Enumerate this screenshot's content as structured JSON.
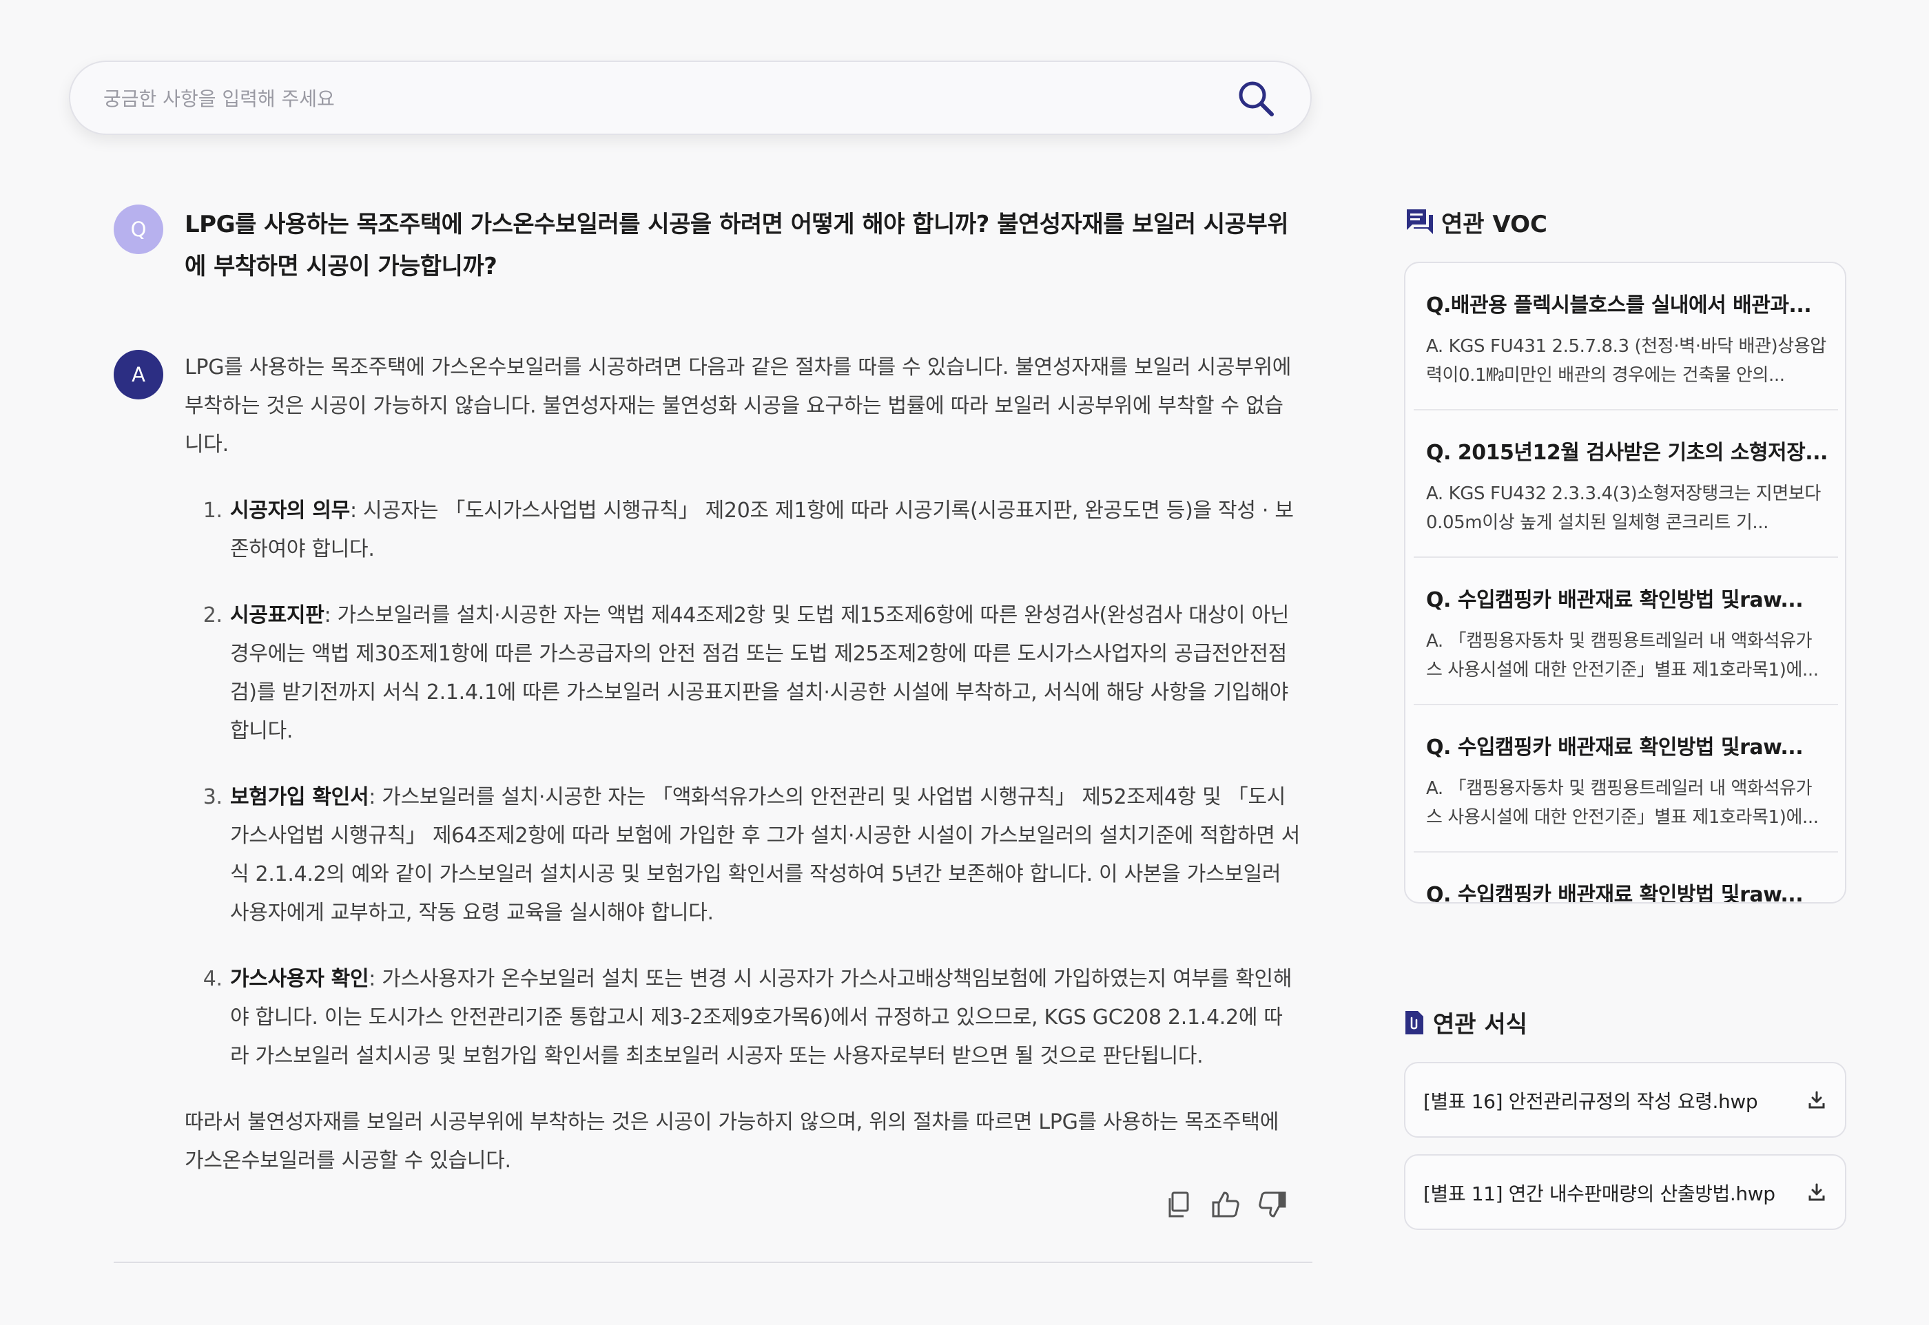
{
  "search": {
    "placeholder": "궁금한 사항을 입력해 주세요"
  },
  "chat": {
    "question_avatar": "Q",
    "answer_avatar": "A",
    "question": "LPG를 사용하는 목조주택에 가스온수보일러를 시공을 하려면 어떻게 해야 합니까? 불연성자재를 보일러 시공부위에 부착하면 시공이 가능합니까?",
    "answer_intro": "LPG를 사용하는 목조주택에 가스온수보일러를 시공하려면 다음과 같은 절차를 따를 수 있습니다. 불연성자재를 보일러 시공부위에 부착하는 것은 시공이 가능하지 않습니다. 불연성자재는 불연성화 시공을 요구하는 법률에 따라 보일러 시공부위에 부착할 수 없습니다.",
    "steps": [
      {
        "title": "시공자의 의무",
        "text": ": 시공자는 「도시가스사업법 시행규칙」 제20조 제1항에 따라 시공기록(시공표지판, 완공도면 등)을 작성 · 보존하여야 합니다."
      },
      {
        "title": "시공표지판",
        "text": ": 가스보일러를 설치·시공한 자는 액법 제44조제2항 및 도법 제15조제6항에 따른 완성검사(완성검사 대상이 아닌 경우에는 액법 제30조제1항에 따른 가스공급자의 안전 점검 또는 도법 제25조제2항에 따른 도시가스사업자의 공급전안전점검)를 받기전까지 서식 2.1.4.1에 따른 가스보일러 시공표지판을 설치·시공한 시설에 부착하고, 서식에 해당 사항을 기입해야 합니다."
      },
      {
        "title": "보험가입 확인서",
        "text": ": 가스보일러를 설치·시공한 자는 「액화석유가스의 안전관리 및 사업법 시행규칙」 제52조제4항 및 「도시가스사업법 시행규칙」 제64조제2항에 따라 보험에 가입한 후 그가 설치·시공한 시설이 가스보일러의 설치기준에 적합하면 서식 2.1.4.2의 예와 같이 가스보일러 설치시공 및 보험가입 확인서를 작성하여 5년간 보존해야 합니다. 이 사본을 가스보일러 사용자에게 교부하고, 작동 요령 교육을 실시해야 합니다."
      },
      {
        "title": "가스사용자 확인",
        "text": ": 가스사용자가 온수보일러 설치 또는 변경 시 시공자가 가스사고배상책임보험에 가입하였는지 여부를 확인해야 합니다. 이는 도시가스 안전관리기준 통합고시 제3-2조제9호가목6)에서 규정하고 있으므로, KGS GC208 2.1.4.2에 따라 가스보일러 설치시공 및 보험가입 확인서를 최초보일러 시공자 또는 사용자로부터 받으면 될 것으로 판단됩니다."
      }
    ],
    "answer_closing": "따라서 불연성자재를 보일러 시공부위에 부착하는 것은 시공이 가능하지 않으며, 위의 절차를 따르면 LPG를 사용하는 목조주택에 가스온수보일러를 시공할 수 있습니다."
  },
  "voc": {
    "title": "연관 VOC",
    "items": [
      {
        "q": "Q.배관용 플렉시블호스를 실내에서 배관과...",
        "a": "A. KGS FU431 2.5.7.8.3 (천정·벽·바닥 배관)상용압력이0.1㎫미만인 배관의 경우에는 건축물 안의..."
      },
      {
        "q": "Q. 2015년12월 검사받은 기초의 소형저장...",
        "a": "A. KGS FU432 2.3.3.4(3)소형저장탱크는 지면보다0.05m이상 높게 설치된 일체형 콘크리트 기..."
      },
      {
        "q": "Q. 수입캠핑카 배관재료 확인방법 및raw...",
        "a": "A. 「캠핑용자동차 및 캠핑용트레일러 내 액화석유가스 사용시설에 대한 안전기준」별표 제1호라목1)에..."
      },
      {
        "q": "Q. 수입캠핑카 배관재료 확인방법 및raw...",
        "a": "A. 「캠핑용자동차 및 캠핑용트레일러 내 액화석유가스 사용시설에 대한 안전기준」별표 제1호라목1)에..."
      },
      {
        "q": "Q. 수입캠핑카 배관재료 확인방법 및raw...",
        "a": ""
      }
    ]
  },
  "forms": {
    "title": "연관 서식",
    "items": [
      {
        "name": "[별표 16] 안전관리규정의 작성 요령.hwp"
      },
      {
        "name": "[별표 11] 연간 내수판매량의 산출방법.hwp"
      }
    ]
  },
  "colors": {
    "accent": "#2c2e83",
    "question_avatar": "#b7b1ee",
    "icons": "#2c2e83"
  },
  "icons": {
    "search": "search-icon",
    "copy": "copy-icon",
    "like": "thumbs-up-icon",
    "dislike": "thumbs-down-icon",
    "voc": "chat-icon",
    "forms": "clip-document-icon",
    "download": "download-icon"
  }
}
